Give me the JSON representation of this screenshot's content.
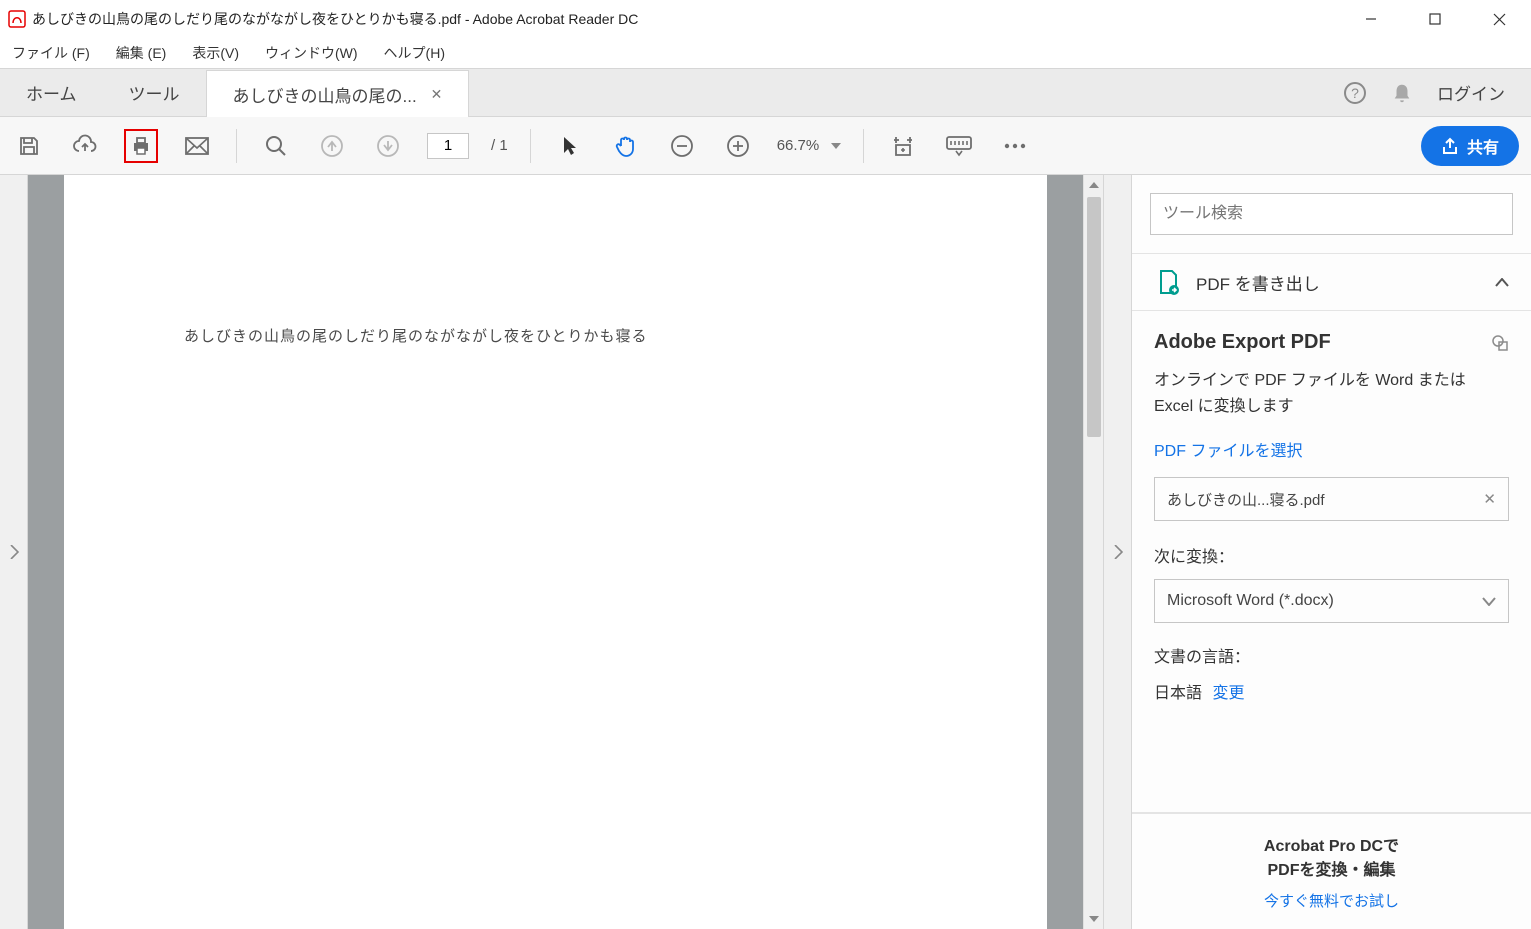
{
  "title": "あしびきの山鳥の尾のしだり尾のながながし夜をひとりかも寝る.pdf - Adobe Acrobat Reader DC",
  "menu": {
    "file": "ファイル (F)",
    "edit": "編集 (E)",
    "view": "表示(V)",
    "window": "ウィンドウ(W)",
    "help": "ヘルプ(H)"
  },
  "tabs": {
    "home": "ホーム",
    "tools": "ツール",
    "doc": "あしびきの山鳥の尾の...",
    "login": "ログイン"
  },
  "toolbar": {
    "page_current": "1",
    "page_total": "/  1",
    "zoom": "66.7%",
    "share": "共有"
  },
  "document": {
    "text": "あしびきの山鳥の尾のしだり尾のながながし夜をひとりかも寝る"
  },
  "panel": {
    "search_placeholder": "ツール検索",
    "export_header": "PDF を書き出し",
    "export_title": "Adobe Export PDF",
    "export_desc": "オンラインで PDF ファイルを Word または Excel に変換します",
    "select_file": "PDF ファイルを選択",
    "current_file": "あしびきの山...寝る.pdf",
    "convert_to_label": "次に変換：",
    "convert_target": "Microsoft Word (*.docx)",
    "doc_lang_label": "文書の言語：",
    "doc_lang_value": "日本語",
    "change": "変更",
    "promo_line1": "Acrobat Pro DCで",
    "promo_line2": "PDFを変換・編集",
    "promo_trial": "今すぐ無料でお試し"
  }
}
